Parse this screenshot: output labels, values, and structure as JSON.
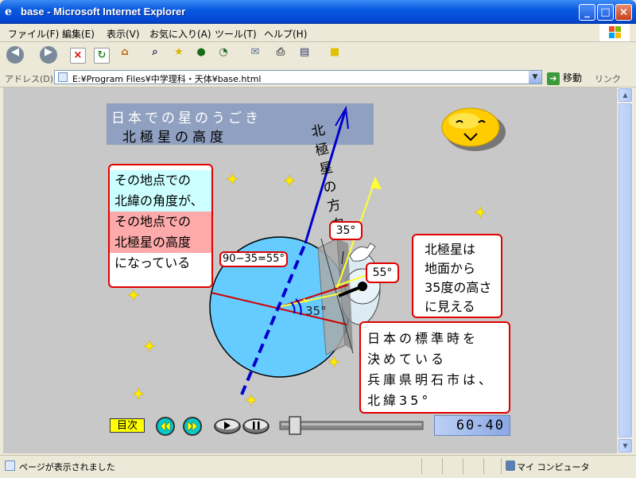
{
  "window": {
    "title": "base - Microsoft Internet Explorer",
    "minimize": "_",
    "maximize": "□",
    "close": "×"
  },
  "menu": [
    "ファイル(F)",
    "編集(E)",
    "表示(V)",
    "お気に入り(A)",
    "ツール(T)",
    "ヘルプ(H)"
  ],
  "address": {
    "label": "アドレス(D)",
    "value": "E:¥Program Files¥中学理科・天体¥base.html",
    "go_label": "移動",
    "links_label": "リンク"
  },
  "lesson": {
    "title": "日本での星のうごき",
    "subtitle": "北極星の高度",
    "pole_label": [
      "北",
      "極",
      "星",
      "の",
      "方",
      "向"
    ],
    "box1": [
      "その地点での",
      "北緯の角度が、",
      "その地点での",
      "北極星の高度",
      "になっている"
    ],
    "box2": [
      "北極星は",
      "地面から",
      "35度の高さ",
      "に見える"
    ],
    "box3": [
      "日本の標準時を",
      "決めている",
      "兵庫県明石市は、",
      "北緯35°"
    ],
    "formula": "90−35=55°",
    "angle35": "35°",
    "angle55": "55°",
    "center_angle": "35°"
  },
  "controls": {
    "menu_button": "目次",
    "counter": "60-40",
    "slider_position": 0.05
  },
  "status": {
    "text": "ページが表示されました",
    "zone": "マイ コンピュータ"
  },
  "colors": {
    "earth": "#66ccff",
    "pole_arrow": "#0000cc",
    "ray": "#ffff33",
    "box_border": "#e00000",
    "highlight_cyan": "#ccffff",
    "highlight_pink": "#ffaaaa"
  }
}
